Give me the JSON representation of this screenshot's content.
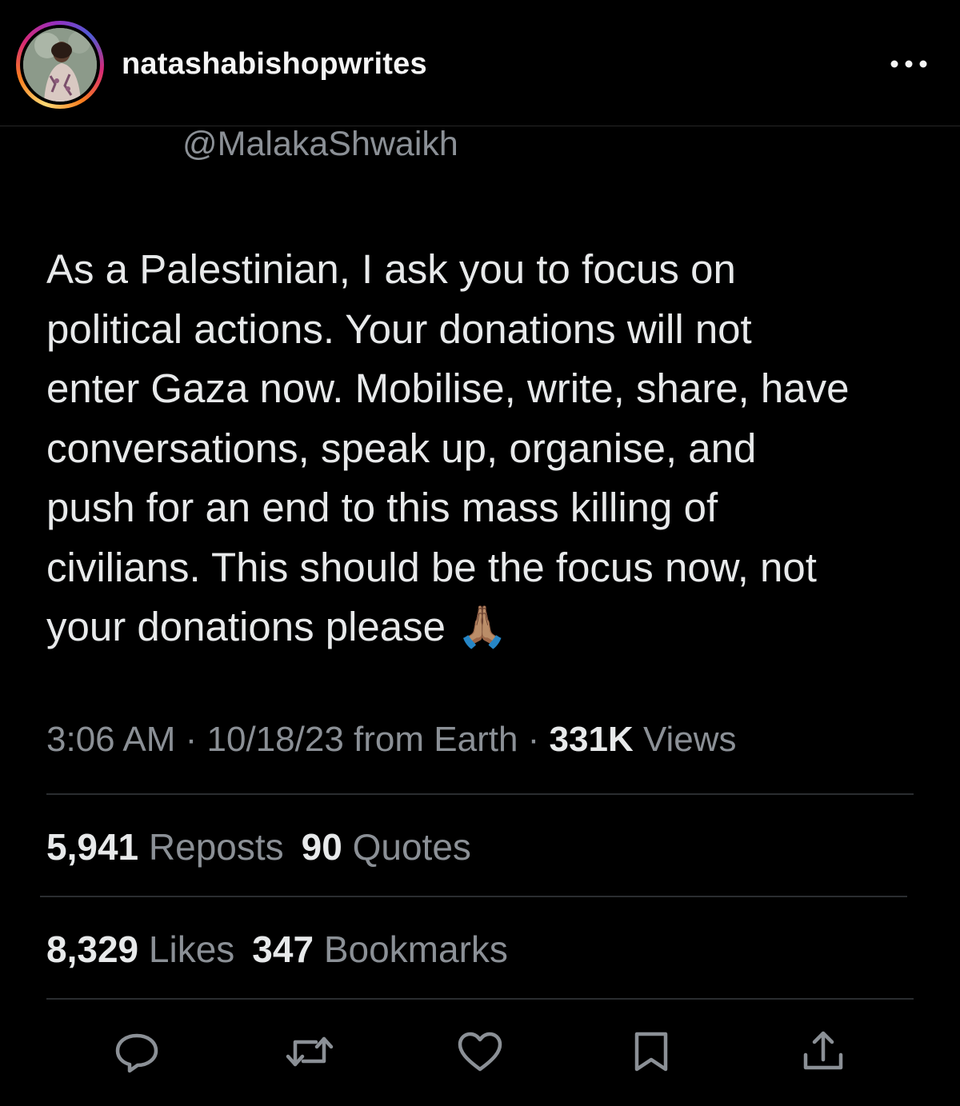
{
  "instagram": {
    "username": "natashabishopwrites",
    "more_icon": "more-horizontal-icon"
  },
  "tweet": {
    "handle": "@MalakaShwaikh",
    "text": "As a Palestinian, I ask you to focus on\npolitical actions. Your donations will not\nenter Gaza now. Mobilise, write, share, have\nconversations, speak up, organise, and\npush for an end to this mass killing of\ncivilians. This should be the focus now, not\nyour donations please",
    "emoji": "🙏🏽",
    "timestamp": "3:06 AM · 10/18/23 from Earth · ",
    "views_count": "331K",
    "views_label": " Views",
    "reposts_count": "5,941",
    "reposts_label": "Reposts",
    "quotes_count": "90",
    "quotes_label": "Quotes",
    "likes_count": "8,329",
    "likes_label": "Likes",
    "bookmarks_count": "347",
    "bookmarks_label": "Bookmarks"
  },
  "actions": [
    {
      "icon": "reply-icon"
    },
    {
      "icon": "retweet-icon"
    },
    {
      "icon": "like-heart-icon"
    },
    {
      "icon": "bookmark-icon"
    },
    {
      "icon": "share-icon"
    }
  ],
  "colors": {
    "background": "#000000",
    "text_primary": "#e7e9ea",
    "text_secondary": "#8b9096",
    "divider": "#2a2d30"
  }
}
